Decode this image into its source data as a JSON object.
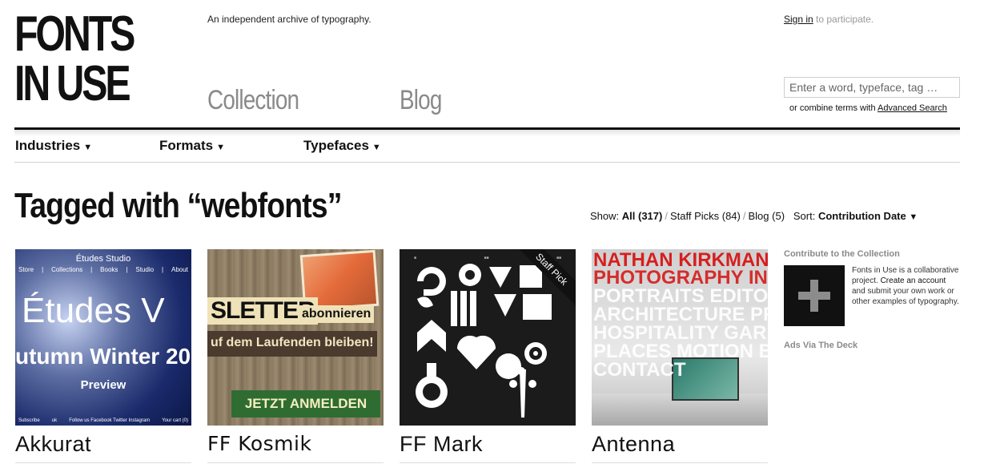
{
  "logo": {
    "line1": "FONTS",
    "line2": "IN USE"
  },
  "tagline": "An independent archive of typography.",
  "nav": {
    "collection": "Collection",
    "blog": "Blog"
  },
  "account": {
    "signin": "Sign in",
    "signin_suffix": " to participate."
  },
  "search": {
    "placeholder": "Enter a word, typeface, tag …",
    "hint_prefix": "or combine terms with ",
    "advanced": "Advanced Search"
  },
  "subnav": [
    {
      "label": "Industries",
      "arrow": "▼"
    },
    {
      "label": "Formats",
      "arrow": "▼"
    },
    {
      "label": "Typefaces",
      "arrow": "▼"
    }
  ],
  "page_title": "Tagged with “webfonts”",
  "filters": {
    "show_label": "Show:",
    "all": "All (317)",
    "staff": "Staff Picks (84)",
    "blog": "Blog (5)",
    "sep": "/",
    "sort_label": "Sort:",
    "sort_value": "Contribution Date",
    "sort_arrow": "▼"
  },
  "cards": [
    {
      "title": "Akkurat",
      "thumb": {
        "header": "Études Studio",
        "menu": [
          "Store",
          "|",
          "Collections",
          "|",
          "Books",
          "|",
          "Studio",
          "|",
          "About"
        ],
        "big1": "Études V",
        "big2": "utumn Winter 20",
        "preview": "Preview",
        "footer": [
          "Subscribe",
          "uk",
          "Follow us Facebook Twitter Instagram",
          "Your cart (0)"
        ]
      }
    },
    {
      "title": "FF Kosmik",
      "thumb": {
        "big": "SLETTER",
        "small": "abonnieren",
        "band": "uf dem Laufenden bleiben!",
        "button": "JETZT ANMELDEN"
      }
    },
    {
      "title": "FF Mark",
      "thumb": {
        "ribbon": "Staff Pick"
      }
    },
    {
      "title": "Antenna",
      "thumb": {
        "lines": [
          "NATHAN KIRKMAN",
          "PHOTOGRAPHY INT",
          "PORTRAITS EDITOR",
          "ARCHITECTURE PRO",
          "HOSPITALITY GARD",
          "PLACES MOTION BI",
          "CONTACT"
        ]
      }
    }
  ],
  "sidebar": {
    "heading": "Contribute to the Collection",
    "text1": "Fonts in Use is a collaborative project.",
    "link": "Create an account",
    "text2": " and submit your own work or other examples of typography.",
    "ads": "Ads Via The Deck"
  },
  "colors": {
    "accent": "#111111",
    "nav_gray": "#8a8a8a",
    "antenna_red": "#d71e1e",
    "kosmik_green": "#2f6c31"
  }
}
